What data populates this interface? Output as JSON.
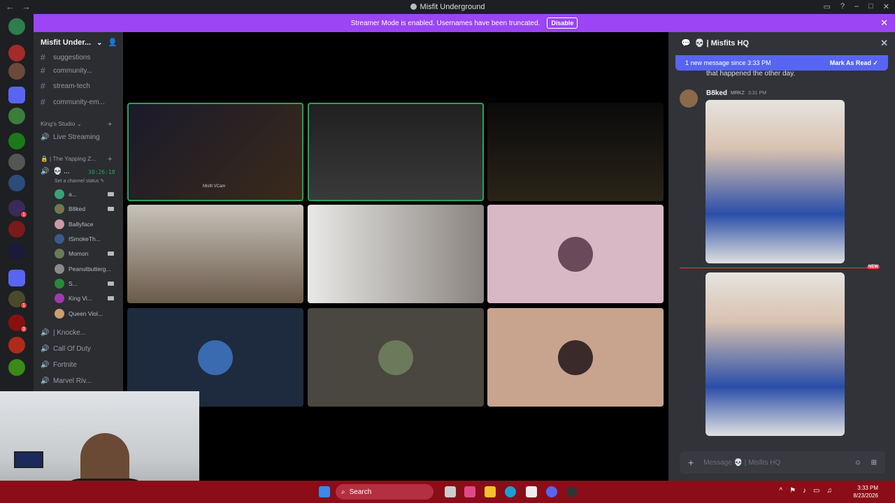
{
  "window": {
    "title": "Misfit Underground"
  },
  "banner": {
    "text": "Streamer Mode is enabled. Usernames have been truncated.",
    "button": "Disable"
  },
  "server": {
    "name": "Misfit Under..."
  },
  "channels": {
    "text": [
      "suggestions",
      "community...",
      "stream-tech",
      "community-em..."
    ],
    "category": "King's Studio",
    "live": "Live Streaming",
    "voice_category": "| The Yapping Z...",
    "current_channel": "...",
    "status_hint": "Set a channel status",
    "timer": "30:26:18",
    "voice_users": [
      "a...",
      "B8ked",
      "Ba8yface",
      "ISmokeTh...",
      "Momon",
      "Peanutbutterg...",
      "S...",
      "King Vi...",
      "Queen Viol..."
    ],
    "other_voice": [
      "| Knocke...",
      "Call Of Duty",
      "Fortnite",
      "Marvel Riv..."
    ]
  },
  "stage": {
    "tile_label": "Misfit VCam"
  },
  "chat": {
    "channel": "💀 | Misfits HQ",
    "new_banner": "1 new message since 3:33 PM",
    "mark_read": "Mark As Read",
    "prev_text": "that happened the other day.",
    "author": "B8ked",
    "tag": "MRKZ",
    "time": "3:31 PM",
    "new_label": "NEW",
    "composer_placeholder": "Message 💀 | Misfits HQ"
  },
  "taskbar": {
    "search": "Search",
    "time": "3:33 PM",
    "date": "8/23/2026"
  },
  "colors": {
    "accent": "#5865f2",
    "banner": "#9b45f5",
    "speaking": "#23a55a",
    "taskbar": "#8b0d18"
  }
}
